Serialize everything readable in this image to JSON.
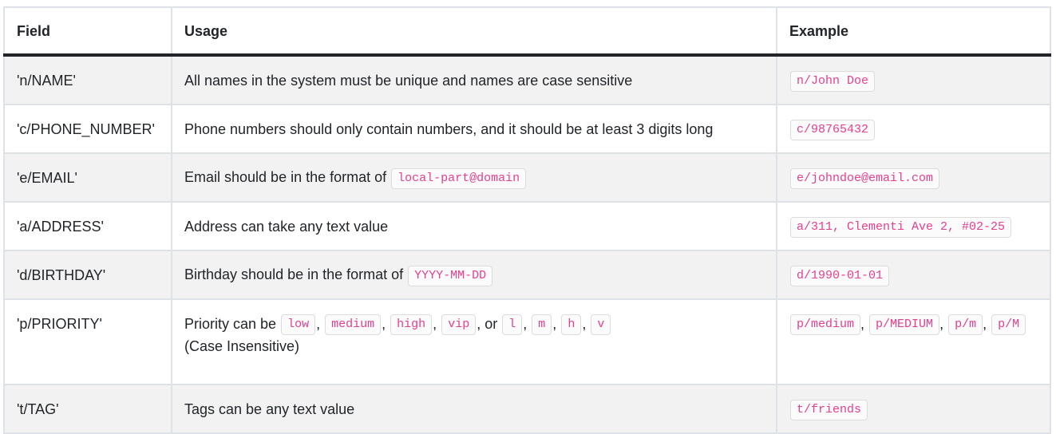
{
  "headers": {
    "field": "Field",
    "usage": "Usage",
    "example": "Example"
  },
  "rows": [
    {
      "field": "'n/NAME'",
      "usage": "All names in the system must be unique and names are case sensitive",
      "example": "n/John Doe"
    },
    {
      "field": "'c/PHONE_NUMBER'",
      "usage": "Phone numbers should only contain numbers, and it should be at least 3 digits long",
      "example": "c/98765432"
    },
    {
      "field": "'e/EMAIL'",
      "usage_prefix": "Email should be in the format of ",
      "usage_code": "local-part@domain",
      "example": "e/johndoe@email.com"
    },
    {
      "field": "'a/ADDRESS'",
      "usage": "Address can take any text value",
      "example": "a/311, Clementi Ave 2, #02-25"
    },
    {
      "field": "'d/BIRTHDAY'",
      "usage_prefix": "Birthday should be in the format of ",
      "usage_code": "YYYY-MM-DD",
      "example": "d/1990-01-01"
    },
    {
      "field": "'p/PRIORITY'",
      "usage_prefix": "Priority can be ",
      "codes": [
        "low",
        "medium",
        "high",
        "vip",
        "l",
        "m",
        "h",
        "v"
      ],
      "or_text": ", or ",
      "comma": ",",
      "usage_line2": "(Case Insensitive)",
      "examples": [
        "p/medium",
        "p/MEDIUM",
        "p/m",
        "p/M"
      ]
    },
    {
      "field": "'t/TAG'",
      "usage": "Tags can be any text value",
      "example": "t/friends"
    }
  ]
}
